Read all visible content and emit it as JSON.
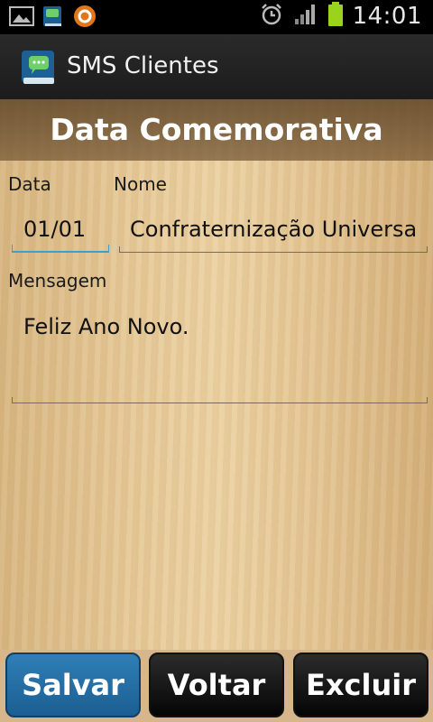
{
  "status_bar": {
    "left_icons": [
      "gallery-icon",
      "sms-clientes-notification-icon",
      "sync-icon"
    ],
    "right_icons": [
      "alarm-icon",
      "signal-icon",
      "battery-icon"
    ],
    "time": "14:01"
  },
  "action_bar": {
    "app_icon": "sms-book-icon",
    "title": "SMS Clientes"
  },
  "form": {
    "header_title": "Data Comemorativa",
    "date_label": "Data",
    "date_value": "01/01",
    "name_label": "Nome",
    "name_value": "Confraternização Universa",
    "message_label": "Mensagem",
    "message_value": "Feliz Ano Novo."
  },
  "buttons": {
    "save_label": "Salvar",
    "back_label": "Voltar",
    "delete_label": "Excluir"
  },
  "colors": {
    "accent_blue": "#2f7fb6",
    "focus_underline": "#3b9fd0",
    "battery_green": "#9ad31b"
  }
}
